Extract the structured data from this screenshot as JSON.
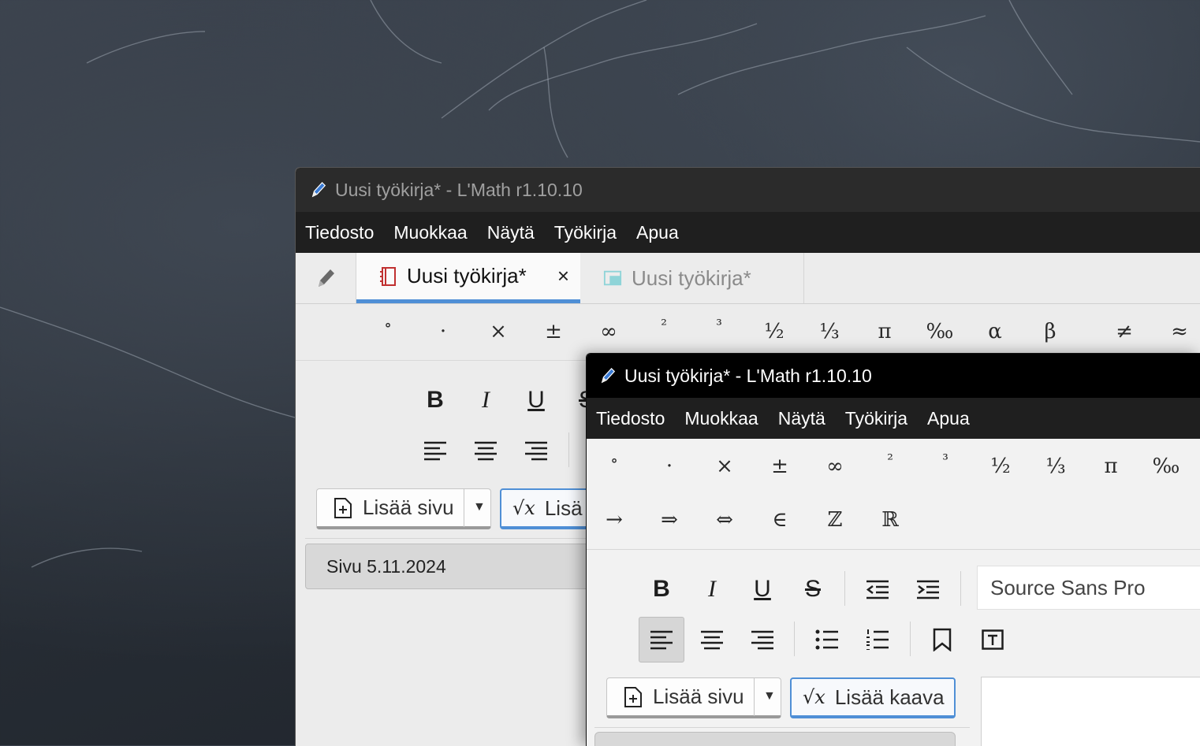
{
  "back_window": {
    "title": "Uusi työkirja* - L'Math r1.10.10",
    "menu": [
      "Tiedosto",
      "Muokkaa",
      "Näytä",
      "Työkirja",
      "Apua"
    ],
    "tabs": [
      {
        "label": "Uusi työkirja*",
        "icon": "notebook-icon",
        "active": true
      },
      {
        "label": "Uusi työkirja*",
        "icon": "worksheet-icon",
        "active": false
      }
    ],
    "tab_close": "×",
    "symbols": [
      "∘",
      "·",
      "×",
      "±",
      "∞",
      "²",
      "³",
      "½",
      "⅓",
      "π",
      "‰",
      "α",
      "β",
      "≠",
      "≈"
    ],
    "format_row1": [
      "B",
      "I",
      "U",
      "S"
    ],
    "add_page_label": "Lisää sivu",
    "add_formula_label": "Lisä",
    "page_label": "Sivu 5.11.2024"
  },
  "front_window": {
    "title": "Uusi työkirja* - L'Math r1.10.10",
    "menu": [
      "Tiedosto",
      "Muokkaa",
      "Näytä",
      "Työkirja",
      "Apua"
    ],
    "symbols_row1": [
      "∘",
      "·",
      "×",
      "±",
      "∞",
      "²",
      "³",
      "½",
      "⅓",
      "π",
      "‰"
    ],
    "symbols_row2": [
      "→",
      "⇒",
      "⇔",
      "∈",
      "ℤ",
      "ℝ"
    ],
    "format_row1": [
      "B",
      "I",
      "U",
      "S"
    ],
    "font_name": "Source Sans Pro",
    "add_page_label": "Lisää sivu",
    "add_formula_label": "Lisää kaava"
  },
  "colors": {
    "accent": "#4f8fd6",
    "front_titlebar": "#000000",
    "back_titlebar": "#2b2b2b"
  }
}
